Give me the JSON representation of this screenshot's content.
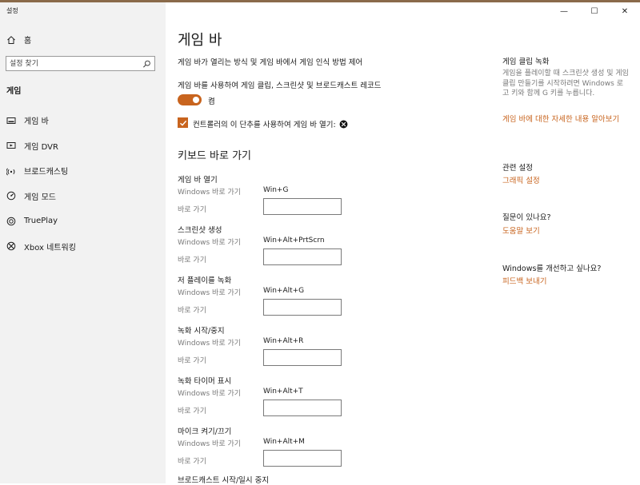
{
  "window": {
    "title": "설정",
    "minimize_glyph": "—",
    "maximize_glyph": "☐",
    "close_glyph": "✕"
  },
  "sidebar": {
    "home_label": "홈",
    "search_placeholder": "설정 찾기",
    "section_label": "게임",
    "items": [
      {
        "label": "게임 바",
        "icon": "game-bar-icon"
      },
      {
        "label": "게임 DVR",
        "icon": "dvr-icon"
      },
      {
        "label": "브로드캐스팅",
        "icon": "broadcast-icon"
      },
      {
        "label": "게임 모드",
        "icon": "game-mode-icon"
      },
      {
        "label": "TruePlay",
        "icon": "trueplay-icon"
      },
      {
        "label": "Xbox 네트워킹",
        "icon": "xbox-icon"
      }
    ]
  },
  "main": {
    "title": "게임 바",
    "description": "게임 바가 열리는 방식 및 게임 바에서 게임 인식 방법 제어",
    "record_label": "게임 바를 사용하여 게임 클립, 스크린샷 및 브로드캐스트 레코드",
    "toggle_state": "켬",
    "toggle_on": true,
    "controller_label": "컨트롤러의 이 단추를 사용하여 게임 바 열기:",
    "controller_checked": true,
    "keyboard_heading": "키보드 바로 가기",
    "shortcut_windows_label": "Windows 바로 가기",
    "shortcut_custom_label": "바로 가기",
    "shortcuts": [
      {
        "title": "게임 바 열기",
        "windows": "Win+G",
        "custom": ""
      },
      {
        "title": "스크린샷 생성",
        "windows": "Win+Alt+PrtScrn",
        "custom": ""
      },
      {
        "title": "저 플레이를 녹화",
        "windows": "Win+Alt+G",
        "custom": ""
      },
      {
        "title": "녹화 시작/중지",
        "windows": "Win+Alt+R",
        "custom": ""
      },
      {
        "title": "녹화 타이머 표시",
        "windows": "Win+Alt+T",
        "custom": ""
      },
      {
        "title": "마이크 켜기/끄기",
        "windows": "Win+Alt+M",
        "custom": ""
      }
    ],
    "last_title": "브로드캐스트 시작/일시 중지"
  },
  "right_panel": {
    "clip_title": "게임 클립 녹화",
    "clip_text": "게임을 플레이할 때 스크린샷 생성 및 게임 클립 만들기를 시작하려면 Windows 로고 키와 함께 G 키를 누릅니다.",
    "clip_link": "게임 바에 대한 자세한 내용 알아보기",
    "related_title": "관련 설정",
    "related_link": "그래픽 설정",
    "question_title": "질문이 있나요?",
    "question_link": "도움말 보기",
    "improve_title": "Windows를 개선하고 싶나요?",
    "improve_link": "피드백 보내기"
  },
  "colors": {
    "accent": "#c8641e",
    "sidebar_bg": "#f2f2f2",
    "secondary_text": "#7a7a7a"
  }
}
